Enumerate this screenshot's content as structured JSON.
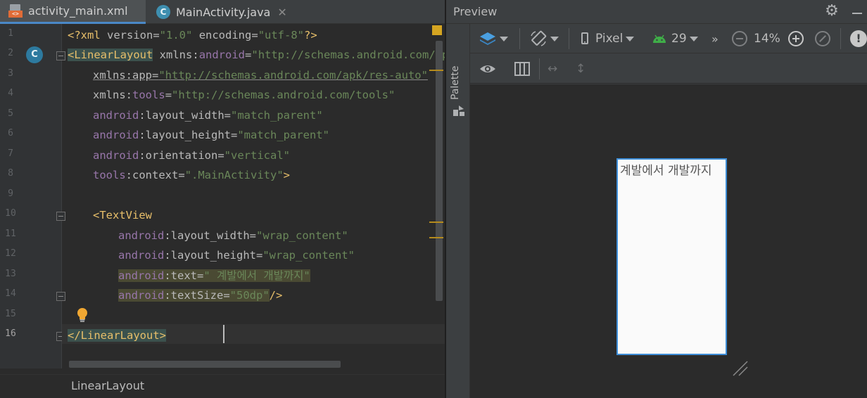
{
  "tabs": [
    {
      "label": "activity_main.xml",
      "close": "",
      "icon": "xml-file-icon",
      "active": true
    },
    {
      "label": "MainActivity.java",
      "close": "✕",
      "icon": "class-icon",
      "active": false
    }
  ],
  "editor": {
    "line_numbers": [
      "1",
      "2",
      "3",
      "4",
      "5",
      "6",
      "7",
      "8",
      "9",
      "10",
      "11",
      "12",
      "13",
      "14",
      "15",
      "16"
    ],
    "gutter_class_icon": "C",
    "lines": {
      "l1": {
        "pi_open": "<?xml ",
        "attr1": "version",
        "eq1": "=",
        "val1": "\"1.0\"",
        "sp": " ",
        "attr2": "encoding",
        "eq2": "=",
        "val2": "\"utf-8\"",
        "pi_close": "?>"
      },
      "l2": {
        "tag": "<LinearLayout",
        "sp": " ",
        "attr": "xmlns",
        "colon": ":",
        "ns": "android",
        "eq": "=",
        "val": "\"http://schemas.android.com/apk/res/android\""
      },
      "l3": {
        "attr": "xmlns:app",
        "eq": "=",
        "val": "\"http://schemas.android.com/apk/res-auto\""
      },
      "l4": {
        "attr": "xmlns",
        "colon": ":",
        "ns": "tools",
        "eq": "=",
        "val": "\"http://schemas.android.com/tools\""
      },
      "l5": {
        "ns": "android",
        "colon": ":",
        "attr": "layout_width",
        "eq": "=",
        "val": "\"match_parent\""
      },
      "l6": {
        "ns": "android",
        "colon": ":",
        "attr": "layout_height",
        "eq": "=",
        "val": "\"match_parent\""
      },
      "l7": {
        "ns": "android",
        "colon": ":",
        "attr": "orientation",
        "eq": "=",
        "val": "\"vertical\""
      },
      "l8": {
        "ns": "tools",
        "colon": ":",
        "attr": "context",
        "eq": "=",
        "val": "\".MainActivity\"",
        "close": ">"
      },
      "l10": {
        "tag": "<TextView"
      },
      "l11": {
        "ns": "android",
        "colon": ":",
        "attr": "layout_width",
        "eq": "=",
        "val": "\"wrap_content\""
      },
      "l12": {
        "ns": "android",
        "colon": ":",
        "attr": "layout_height",
        "eq": "=",
        "val": "\"wrap_content\""
      },
      "l13": {
        "ns": "android",
        "colon": ":",
        "attr": "text",
        "eq": "=",
        "val": "\" 계발에서 개발까지\""
      },
      "l14": {
        "ns": "android",
        "colon": ":",
        "attr": "textSize",
        "eq": "=",
        "val": "\"50dp\"",
        "close": "/>"
      },
      "l16": {
        "tag": "</LinearLayout",
        "close": ">"
      }
    }
  },
  "breadcrumb": "LinearLayout",
  "preview": {
    "title": "Preview",
    "palette_label": "Palette",
    "toolbar": {
      "device": "Pixel",
      "api_level": "29",
      "more": "»",
      "zoom": "14%"
    },
    "device_text": "계발에서 개발까지"
  },
  "colors": {
    "tag": "#e8bf6a",
    "namespace": "#9876aa",
    "value": "#6a8759",
    "selection_border": "#3e8ed8",
    "android_green": "#3fae48"
  }
}
